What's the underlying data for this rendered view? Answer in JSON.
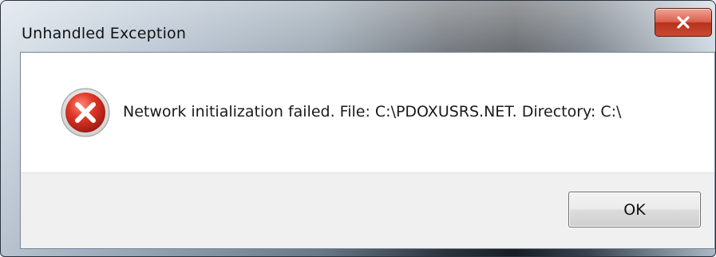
{
  "dialog": {
    "title": "Unhandled Exception",
    "message": "Network initialization failed. File: C:\\PDOXUSRS.NET. Directory: C:\\",
    "icon": "error-icon",
    "ok_label": "OK",
    "close_icon": "close-icon"
  },
  "colors": {
    "error_red": "#d42a1e",
    "close_button": "#c94a32"
  }
}
